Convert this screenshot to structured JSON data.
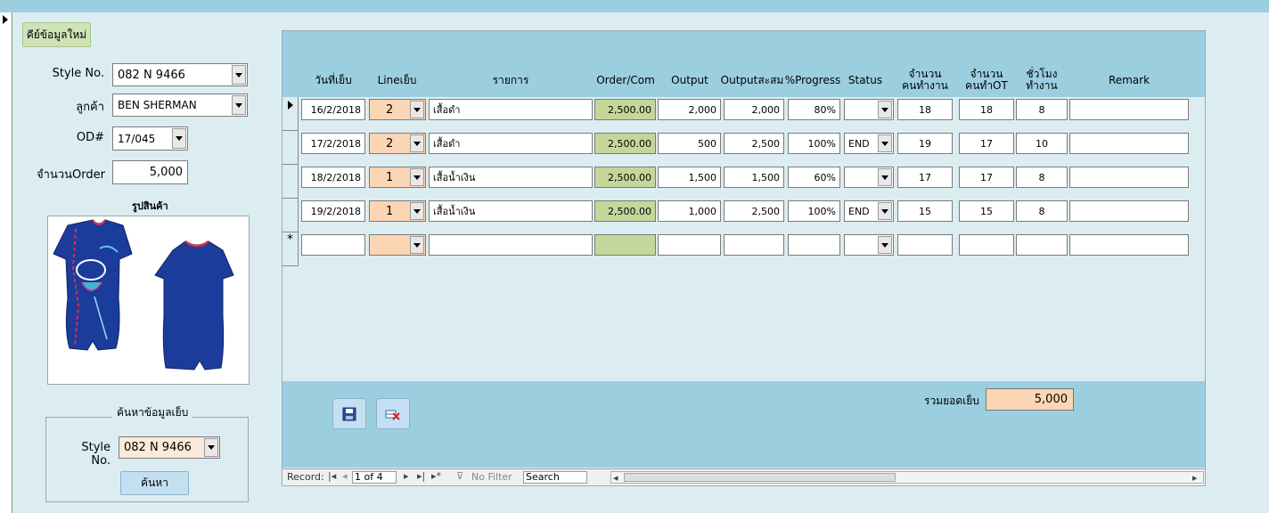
{
  "form": {
    "new_entry_label": "คีย์ข้อมูลใหม่",
    "style_no_label": "Style No.",
    "style_no_value": "082 N 9466",
    "customer_label": "ลูกค้า",
    "customer_value": "BEN SHERMAN",
    "od_label": "OD#",
    "od_value": "17/045",
    "order_qty_label": "จำนวนOrder",
    "order_qty_value": "5,000",
    "picture_label": "รูปสินค้า"
  },
  "search": {
    "group_title": "ค้นหาข้อมูลเย็บ",
    "style_no_label": "Style No.",
    "style_no_value": "082 N 9466",
    "button_label": "ค้นหา"
  },
  "grid": {
    "headers": {
      "date": "วันที่เย็บ",
      "line": "Lineเย็บ",
      "item": "รายการ",
      "order": "Order/Com",
      "output": "Output",
      "cumulative": "Outputสะสม",
      "progress": "%Progress",
      "status": "Status",
      "workers_1": "จำนวน",
      "workers_2": "คนทำงาน",
      "ot_1": "จำนวน",
      "ot_2": "คนทำOT",
      "hours_1": "ชั่วโมง",
      "hours_2": "ทำงาน",
      "remark": "Remark"
    },
    "rows": [
      {
        "date": "16/2/2018",
        "line": "2",
        "item": "เสื้อดำ",
        "order": "2,500.00",
        "output": "2,000",
        "cumulative": "2,000",
        "progress": "80%",
        "status": "",
        "workers": "18",
        "ot": "18",
        "hours": "8",
        "remark": ""
      },
      {
        "date": "17/2/2018",
        "line": "2",
        "item": "เสื้อดำ",
        "order": "2,500.00",
        "output": "500",
        "cumulative": "2,500",
        "progress": "100%",
        "status": "END",
        "workers": "19",
        "ot": "17",
        "hours": "10",
        "remark": ""
      },
      {
        "date": "18/2/2018",
        "line": "1",
        "item": "เสื้อน้ำเงิน",
        "order": "2,500.00",
        "output": "1,500",
        "cumulative": "1,500",
        "progress": "60%",
        "status": "",
        "workers": "17",
        "ot": "17",
        "hours": "8",
        "remark": ""
      },
      {
        "date": "19/2/2018",
        "line": "1",
        "item": "เสื้อน้ำเงิน",
        "order": "2,500.00",
        "output": "1,000",
        "cumulative": "2,500",
        "progress": "100%",
        "status": "END",
        "workers": "15",
        "ot": "15",
        "hours": "8",
        "remark": ""
      }
    ],
    "new_row_marker": "*"
  },
  "footer": {
    "total_label": "รวมยอดเย็บ",
    "total_value": "5,000"
  },
  "navigation": {
    "record_label": "Record:",
    "position": "1 of 4",
    "filter_label": "No Filter",
    "search_label": "Search"
  },
  "colors": {
    "header_blue": "#9bcfe0",
    "line_cell_orange": "#fcd5b4",
    "order_cell_green": "#c4d79b"
  }
}
